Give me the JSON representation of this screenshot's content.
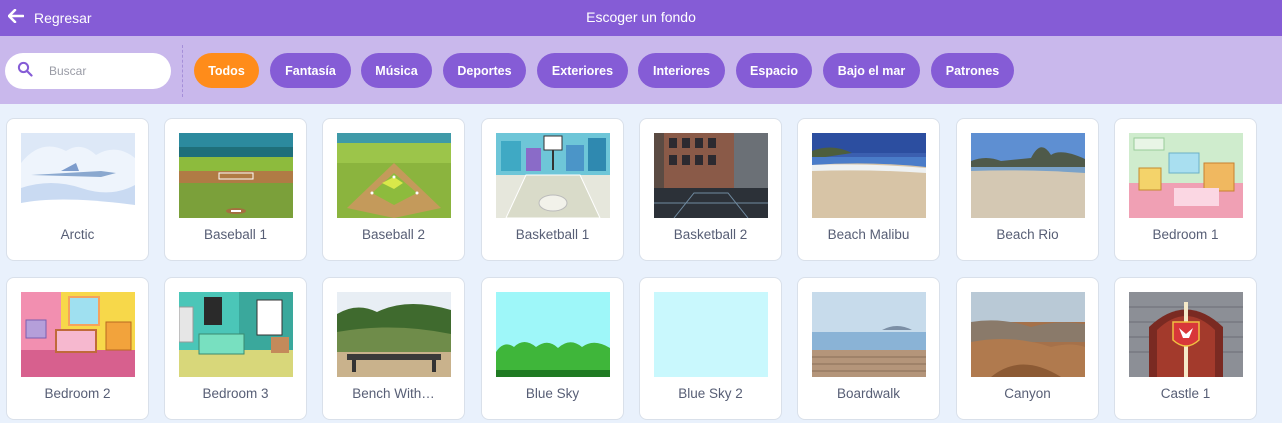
{
  "header": {
    "back_label": "Regresar",
    "title": "Escoger un fondo"
  },
  "search": {
    "placeholder": "Buscar"
  },
  "tags": [
    {
      "label": "Todos",
      "active": true
    },
    {
      "label": "Fantasía"
    },
    {
      "label": "Música"
    },
    {
      "label": "Deportes"
    },
    {
      "label": "Exteriores"
    },
    {
      "label": "Interiores"
    },
    {
      "label": "Espacio"
    },
    {
      "label": "Bajo el mar"
    },
    {
      "label": "Patrones"
    }
  ],
  "backdrops": [
    {
      "name": "Arctic",
      "thumb_icon": "arctic-thumbnail"
    },
    {
      "name": "Baseball 1",
      "thumb_icon": "baseball-field-thumbnail"
    },
    {
      "name": "Baseball 2",
      "thumb_icon": "baseball-diamond-thumbnail"
    },
    {
      "name": "Basketball 1",
      "thumb_icon": "basketball-court-thumbnail"
    },
    {
      "name": "Basketball 2",
      "thumb_icon": "city-court-thumbnail"
    },
    {
      "name": "Beach Malibu",
      "thumb_icon": "beach-thumbnail"
    },
    {
      "name": "Beach Rio",
      "thumb_icon": "beach-mountain-thumbnail"
    },
    {
      "name": "Bedroom 1",
      "thumb_icon": "bedroom-thumbnail"
    },
    {
      "name": "Bedroom 2",
      "thumb_icon": "bedroom-thumbnail"
    },
    {
      "name": "Bedroom 3",
      "thumb_icon": "bedroom-thumbnail"
    },
    {
      "name": "Bench With…",
      "thumb_icon": "bench-view-thumbnail"
    },
    {
      "name": "Blue Sky",
      "thumb_icon": "sky-bushes-thumbnail"
    },
    {
      "name": "Blue Sky 2",
      "thumb_icon": "plain-sky-thumbnail"
    },
    {
      "name": "Boardwalk",
      "thumb_icon": "boardwalk-thumbnail"
    },
    {
      "name": "Canyon",
      "thumb_icon": "canyon-thumbnail"
    },
    {
      "name": "Castle 1",
      "thumb_icon": "castle-gate-thumbnail"
    }
  ],
  "colors": {
    "header": "#855cd6",
    "filter_bar": "#c9b8ec",
    "tag": "#855cd6",
    "tag_active": "#ff8c1a",
    "page_bg": "#e9f1fc",
    "label_text": "#575e75"
  }
}
